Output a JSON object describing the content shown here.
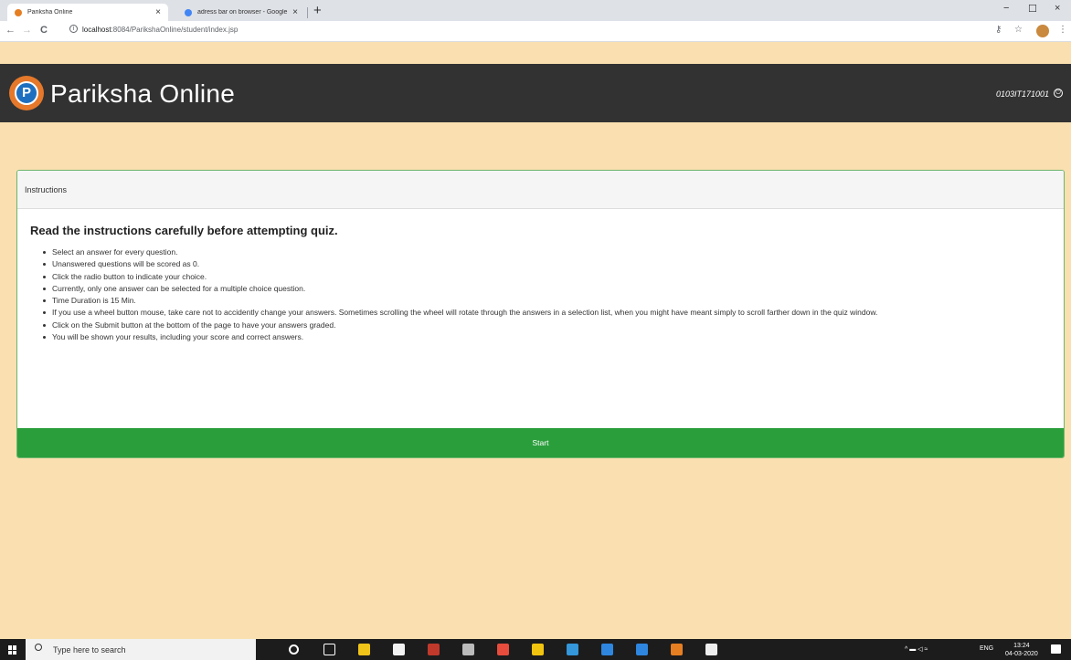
{
  "browser": {
    "tabs": [
      {
        "title": "Pariksha Online",
        "close": "×",
        "favicon_color": "#e67e22"
      },
      {
        "title": "adress bar on browser - Google",
        "close": "×",
        "favicon_color": "#4285f4"
      }
    ],
    "new_tab": "+",
    "window_controls": {
      "minimize": "−",
      "maximize": "☐",
      "close": "×"
    },
    "nav": {
      "back": "←",
      "forward": "→",
      "reload": "C"
    },
    "url_host": "localhost",
    "url_rest": ":8084/ParikshaOnline/student/index.jsp",
    "toolbar_icons": {
      "key": "⚷",
      "star": "☆",
      "menu": "⋮"
    }
  },
  "app": {
    "logo_letter": "P",
    "brand": "Pariksha Online",
    "user_id": "0103IT171001"
  },
  "card": {
    "header": "Instructions",
    "heading": "Read the instructions carefully before attempting quiz.",
    "items": [
      "Select an answer for every question.",
      "Unanswered questions will be scored as 0.",
      "Click the radio button to indicate your choice.",
      "Currently, only one answer can be selected for a multiple choice question.",
      "Time Duration is 15 Min.",
      "If you use a wheel button mouse, take care not to accidently change your answers. Sometimes scrolling the wheel will rotate through the answers in a selection list, when you might have meant simply to scroll farther down in the quiz window.",
      "Click on the Submit button at the bottom of the page to have your answers graded.",
      "You will be shown your results, including your score and correct answers."
    ],
    "start_label": "Start"
  },
  "taskbar": {
    "search_placeholder": "Type here to search",
    "apps": [
      {
        "name": "cortana-icon",
        "color": "#1c1c1c"
      },
      {
        "name": "task-view-icon",
        "color": "#1c1c1c"
      },
      {
        "name": "file-explorer-icon",
        "color": "#f0c419"
      },
      {
        "name": "store-icon",
        "color": "#f2f2f2"
      },
      {
        "name": "mcafee-icon",
        "color": "#c0392b"
      },
      {
        "name": "terminal-icon",
        "color": "#bbbbbb"
      },
      {
        "name": "opera-icon",
        "color": "#e74c3c"
      },
      {
        "name": "chrome-icon",
        "color": "#f1c40f"
      },
      {
        "name": "virtualbox-icon",
        "color": "#3498db"
      },
      {
        "name": "app-icon",
        "color": "#2e86de"
      },
      {
        "name": "app2-icon",
        "color": "#2e86de"
      },
      {
        "name": "app3-icon",
        "color": "#e67e22"
      },
      {
        "name": "photos-icon",
        "color": "#eeeeee"
      }
    ],
    "tray_lang": "ENG",
    "time": "13:24",
    "date": "04-03-2020"
  },
  "colors": {
    "page_bg": "#fae0b0",
    "header_bg": "#323232",
    "start_button": "#2b9e3c",
    "card_border": "#6cb66c"
  }
}
